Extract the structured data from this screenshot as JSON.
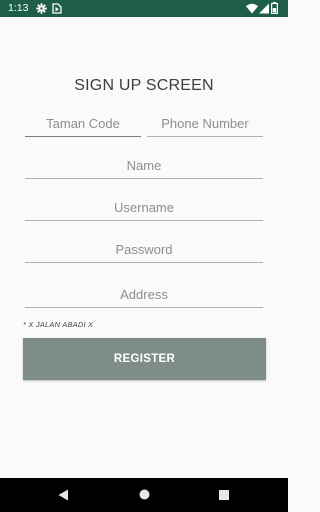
{
  "status_bar": {
    "time": "1:13",
    "icons": [
      "gear-icon",
      "media-icon",
      "wifi-icon",
      "signal-icon",
      "battery-icon"
    ],
    "background": "#1e5e46"
  },
  "title": "SIGN UP SCREEN",
  "form": {
    "taman_code": {
      "placeholder": "Taman Code",
      "value": ""
    },
    "phone_number": {
      "placeholder": "Phone Number",
      "value": ""
    },
    "name": {
      "placeholder": "Name",
      "value": ""
    },
    "username": {
      "placeholder": "Username",
      "value": ""
    },
    "password": {
      "placeholder": "Password",
      "value": ""
    },
    "address": {
      "placeholder": "Address",
      "value": ""
    },
    "address_hint": "* X JALAN ABADI X"
  },
  "register_label": "REGISTER",
  "nav_bar": {
    "icons": [
      "back-icon",
      "home-icon",
      "recents-icon"
    ]
  },
  "colors": {
    "status_bar": "#1e5e46",
    "button": "#7e8c8a",
    "background": "#fafafa"
  }
}
